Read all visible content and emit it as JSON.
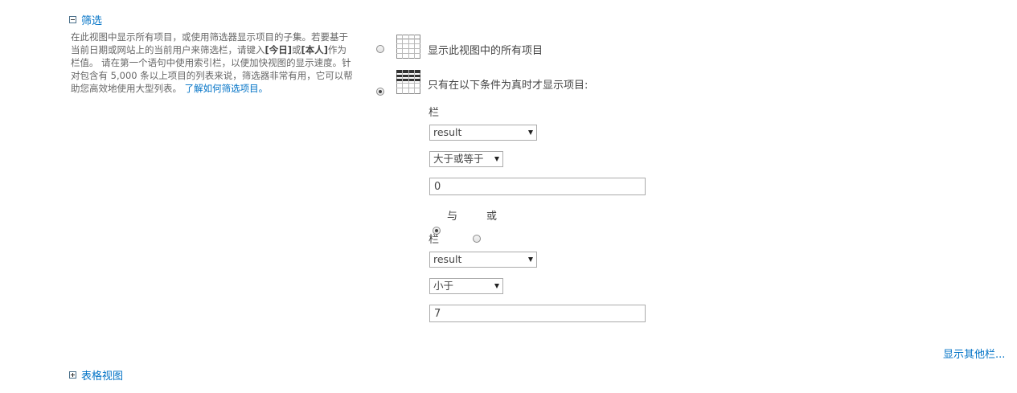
{
  "filter_section": {
    "title": "筛选",
    "desc_part1": "在此视图中显示所有项目，或使用筛选器显示项目的子集。若要基于当前日期或网站上的当前用户来筛选栏，请键入",
    "desc_today": "[今日]",
    "desc_or": "或",
    "desc_me": "[本人]",
    "desc_part2": "作为栏值。 请在第一个语句中使用索引栏，以便加快视图的显示速度。针对包含有 5,000 条以上项目的列表来说，筛选器非常有用，它可以帮助您高效地使用大型列表。 ",
    "desc_link": "了解如何筛选项目。",
    "option_all": "显示此视图中的所有项目",
    "option_conditional": "只有在以下条件为真时才显示项目:",
    "condition1": {
      "column_label": "栏",
      "column_value": "result",
      "operator_value": "大于或等于",
      "value": "0"
    },
    "join": {
      "and_label": "与",
      "or_label": "或"
    },
    "condition2": {
      "column_label": "栏",
      "column_value": "result",
      "operator_value": "小于",
      "value": "7"
    },
    "show_more_columns": "显示其他栏..."
  },
  "table_view_section": {
    "title": "表格视图"
  }
}
